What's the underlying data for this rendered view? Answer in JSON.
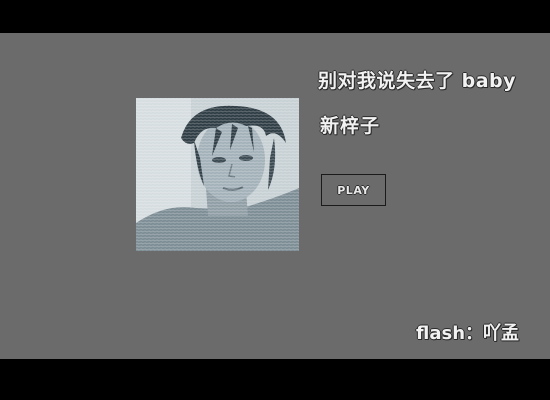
{
  "song": {
    "title": "别对我说失去了 baby",
    "artist": "新梓子"
  },
  "controls": {
    "play_label": "PLAY"
  },
  "credit": {
    "text": "flash：吖孟"
  },
  "colors": {
    "letterbox": "#000000",
    "stage": "#6b6b6b",
    "text": "#f2f2f2",
    "photo_tint": "#b9c4c8"
  },
  "icons": {
    "photo": "portrait-photo"
  }
}
